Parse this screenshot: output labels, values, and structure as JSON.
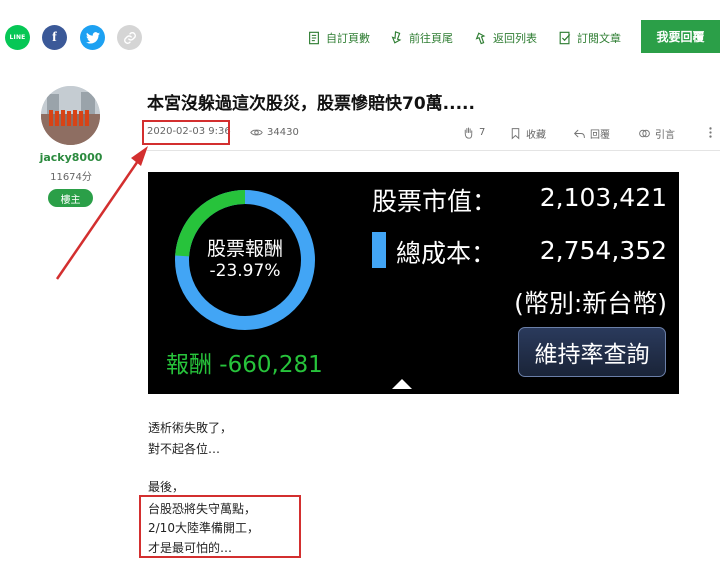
{
  "share": {
    "line_label": "LINE",
    "fb_label": "f"
  },
  "toolbar": {
    "subscribe_forum": "自訂頁數",
    "go_last": "前往頁尾",
    "back_list": "返回列表",
    "subscribe_article": "訂閱文章",
    "reply": "我要回覆"
  },
  "author": {
    "name": "jacky8000",
    "points": "11674分",
    "badge": "樓主"
  },
  "post": {
    "title": "本宮沒躲過這次股災，股票慘賠快70萬.....",
    "date": "2020-02-03 9:36",
    "views": "34430",
    "gp": "7",
    "bookmark": "收藏",
    "reply": "回覆",
    "quote": "引言"
  },
  "stock_panel": {
    "donut_title": "股票報酬",
    "return_pct": "-23.97%",
    "return_fraction": 0.2397,
    "return_label": "報酬 -660,281",
    "market_value_label": "股票市值：",
    "market_value": "2,103,421",
    "total_cost_label": "總成本：",
    "total_cost": "2,754,352",
    "currency": "(幣別:新台幣)",
    "margin_button": "維持率查詢",
    "colors": {
      "ring_blue": "#42a5f5",
      "ring_green": "#27c33b"
    }
  },
  "body_lines": [
    "透析術失敗了，",
    "對不起各位…",
    "",
    "最後，",
    "台股恐將失守萬點，",
    "2/10大陸準備開工，",
    "才是最可怕的…"
  ],
  "annotation_color": "#d32f2f"
}
